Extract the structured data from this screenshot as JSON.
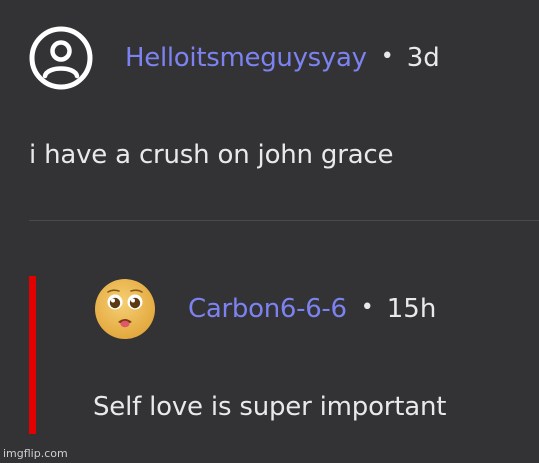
{
  "comments": [
    {
      "avatar_icon": "user-default-icon",
      "username": "Helloitsmeguysyay",
      "separator": "•",
      "time": "3d",
      "text": "i have a crush on john grace"
    },
    {
      "avatar_icon": "pleading-face-emoji-icon",
      "username": "Carbon6-6-6",
      "separator": "•",
      "time": "15h",
      "text": "Self love is super important"
    }
  ],
  "colors": {
    "background": "#333335",
    "username": "#7c82f0",
    "text": "#e9e9ea",
    "reply_bar": "#e20000"
  },
  "watermark": "imgflip.com"
}
